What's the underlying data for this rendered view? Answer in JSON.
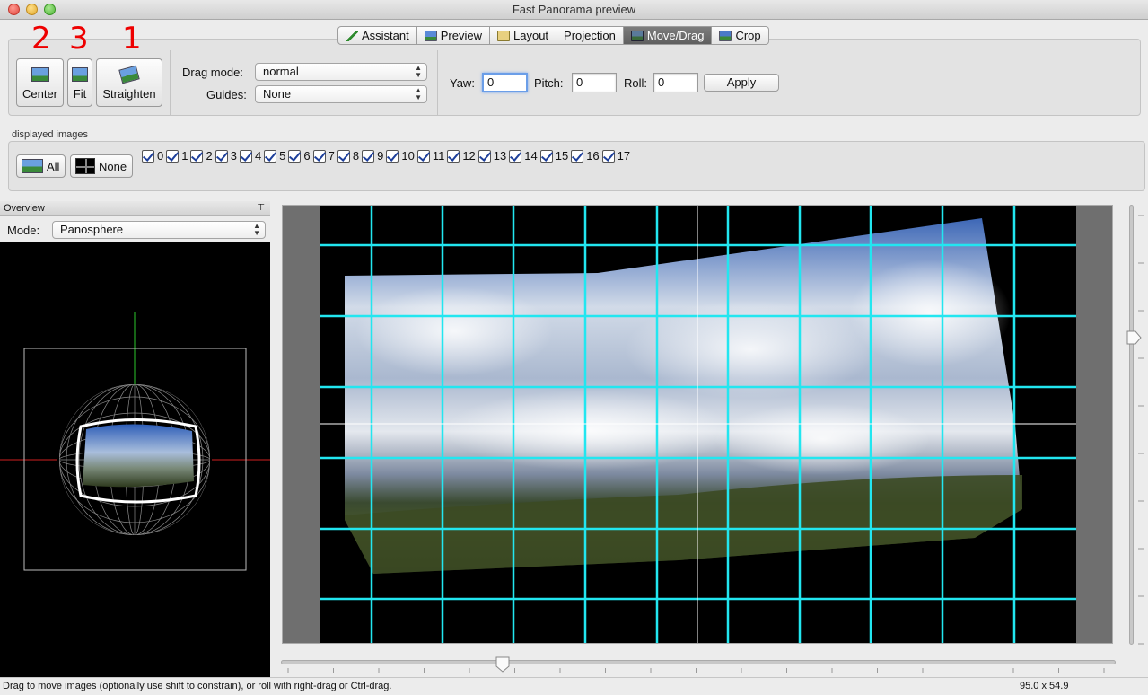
{
  "window": {
    "title": "Fast Panorama preview"
  },
  "tabs": [
    {
      "label": "Assistant",
      "icon": "wand-icon"
    },
    {
      "label": "Preview",
      "icon": "landscape-icon"
    },
    {
      "label": "Layout",
      "icon": "layout-icon"
    },
    {
      "label": "Projection",
      "icon": ""
    },
    {
      "label": "Move/Drag",
      "icon": "move-icon",
      "active": true
    },
    {
      "label": "Crop",
      "icon": "crop-icon"
    }
  ],
  "toolbar": {
    "center_label": "Center",
    "fit_label": "Fit",
    "straighten_label": "Straighten",
    "center_number": "2",
    "fit_number": "3",
    "straighten_number": "1",
    "drag_mode_label": "Drag mode:",
    "drag_mode_value": "normal",
    "guides_label": "Guides:",
    "guides_value": "None",
    "yaw_label": "Yaw:",
    "yaw_value": "0",
    "pitch_label": "Pitch:",
    "pitch_value": "0",
    "roll_label": "Roll:",
    "roll_value": "0",
    "apply_label": "Apply"
  },
  "displayed_images": {
    "label": "displayed images",
    "all_label": "All",
    "none_label": "None",
    "items": [
      "0",
      "1",
      "2",
      "3",
      "4",
      "5",
      "6",
      "7",
      "8",
      "9",
      "10",
      "11",
      "12",
      "13",
      "14",
      "15",
      "16",
      "17"
    ]
  },
  "overview": {
    "title": "Overview",
    "mode_label": "Mode:",
    "mode_value": "Panosphere"
  },
  "status": {
    "message": "Drag to move images (optionally use shift to constrain), or roll with right-drag or Ctrl-drag.",
    "fov": "95.0 x 54.9"
  },
  "colors": {
    "guide_cyan": "#22e6f0",
    "annotation_red": "#ee0000",
    "active_tab": "#6a6a6a"
  }
}
